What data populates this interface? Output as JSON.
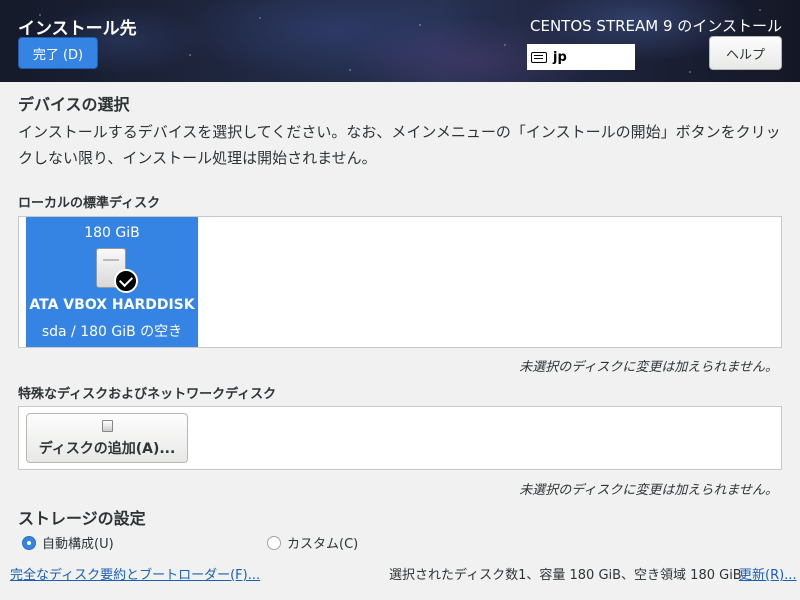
{
  "header": {
    "title": "インストール先",
    "done_button": "完了 (D)",
    "product": "CENTOS STREAM 9 のインストール",
    "keyboard_layout": "jp",
    "help_button": "ヘルプ"
  },
  "device_selection": {
    "title": "デバイスの選択",
    "description": "インストールするデバイスを選択してください。なお、メインメニューの「インストールの開始」ボタンをクリックしない限り、インストール処理は開始されません。"
  },
  "local_disks": {
    "label": "ローカルの標準ディスク",
    "disks": [
      {
        "size": "180 GiB",
        "name": "ATA VBOX HARDDISK",
        "detail": "sda  /  180 GiB の空き",
        "selected": true
      }
    ],
    "note": "未選択のディスクに変更は加えられません。"
  },
  "special_disks": {
    "label": "特殊なディスクおよびネットワークディスク",
    "add_button": "ディスクの追加(A)...",
    "note": "未選択のディスクに変更は加えられません。"
  },
  "storage_config": {
    "title": "ストレージの設定",
    "options": [
      {
        "label": "自動構成(U)",
        "selected": true
      },
      {
        "label": "カスタム(C)",
        "selected": false
      }
    ]
  },
  "footer": {
    "summary_link": "完全なディスク要約とブートローダー(F)...",
    "summary_text": "選択されたディスク数1、容量 180 GiB、空き領域 180 GiB",
    "refresh_link": "更新(R)..."
  },
  "colors": {
    "accent": "#3584e4",
    "link": "#1a5fb4"
  }
}
